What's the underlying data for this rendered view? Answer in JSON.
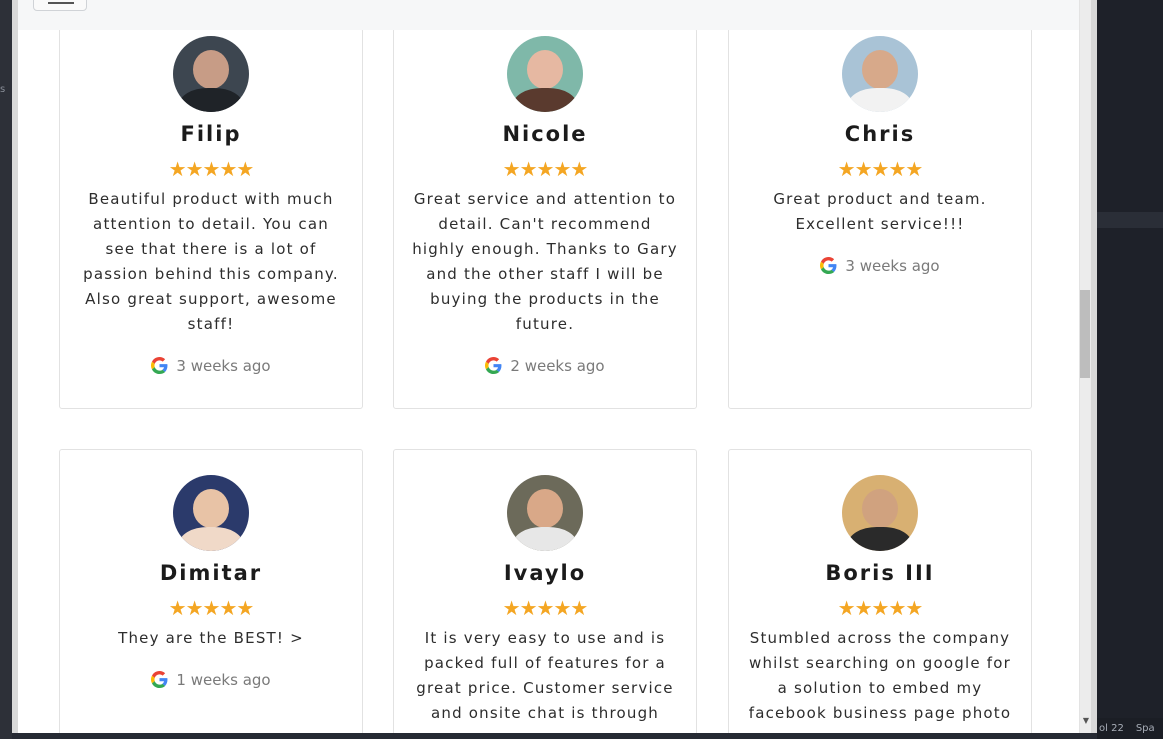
{
  "editor_status": [
    "ol 22",
    "Spa"
  ],
  "reviews": [
    {
      "name": "Filip",
      "rating": 5,
      "stars": "★★★★★",
      "text": "Beautiful product with much attention to detail. You can see that there is a lot of passion behind this company. Also great support, awesome staff!",
      "time": "3 weeks ago",
      "avatar_colors": {
        "bg": "#3d4650",
        "face": "#c79c86",
        "body": "#1f2328"
      }
    },
    {
      "name": "Nicole",
      "rating": 5,
      "stars": "★★★★★",
      "text": "Great service and attention to detail. Can't recommend highly enough. Thanks to Gary and the other staff I will be buying the products in the future.",
      "time": "2 weeks ago",
      "avatar_colors": {
        "bg": "#7fb8a9",
        "face": "#e6b8a2",
        "body": "#5a3a2e"
      }
    },
    {
      "name": "Chris",
      "rating": 5,
      "stars": "★★★★★",
      "text": "Great product and team. Excellent service!!!",
      "time": "3 weeks ago",
      "avatar_colors": {
        "bg": "#a9c3d6",
        "face": "#d7a98a",
        "body": "#f2f2f2"
      }
    },
    {
      "name": "Dimitar",
      "rating": 5,
      "stars": "★★★★★",
      "text": "They are the BEST! >",
      "time": "1 weeks ago",
      "avatar_colors": {
        "bg": "#2b3a6b",
        "face": "#e8c3a6",
        "body": "#f0d9c8"
      }
    },
    {
      "name": "Ivaylo",
      "rating": 5,
      "stars": "★★★★★",
      "text": "It is very easy to use and is packed full of features for a great price. Customer service and onsite chat is through",
      "time": "",
      "avatar_colors": {
        "bg": "#6c6a5a",
        "face": "#d9a888",
        "body": "#e7e7e7"
      }
    },
    {
      "name": "Boris III",
      "rating": 5,
      "stars": "★★★★★",
      "text": "Stumbled across the company whilst searching on google for a solution to embed my facebook business page photo",
      "time": "",
      "avatar_colors": {
        "bg": "#d8b072",
        "face": "#d0a27f",
        "body": "#2a2a2a"
      }
    }
  ],
  "colors": {
    "star": "#f4a623",
    "google_blue": "#4285F4",
    "google_red": "#EA4335",
    "google_yellow": "#FBBC05",
    "google_green": "#34A853"
  }
}
